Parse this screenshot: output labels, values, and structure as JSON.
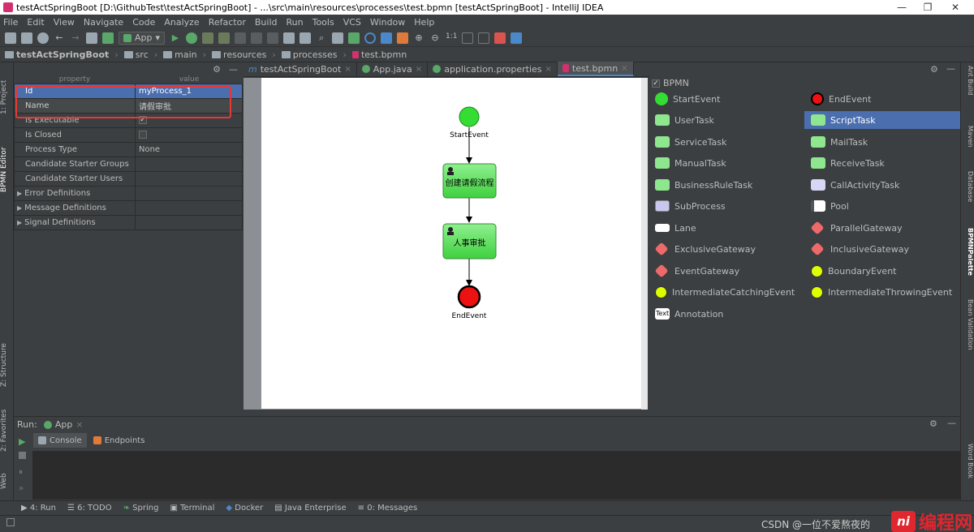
{
  "window": {
    "title": "testActSpringBoot [D:\\GithubTest\\testActSpringBoot] - ...\\src\\main\\resources\\processes\\test.bpmn [testActSpringBoot] - IntelliJ IDEA",
    "minimize": "—",
    "maximize": "❐",
    "close": "✕"
  },
  "menu": [
    "File",
    "Edit",
    "View",
    "Navigate",
    "Code",
    "Analyze",
    "Refactor",
    "Build",
    "Run",
    "Tools",
    "VCS",
    "Window",
    "Help"
  ],
  "toolbar": {
    "run_config": "App"
  },
  "breadcrumb": [
    "testActSpringBoot",
    "src",
    "main",
    "resources",
    "processes",
    "test.bpmn"
  ],
  "left_tabs": {
    "project": "1: Project",
    "bpmn_editor": "BPMN Editor",
    "structure": "Z: Structure",
    "favorites": "2: Favorites",
    "web": "Web"
  },
  "properties": {
    "col_property": "property",
    "col_value": "value",
    "rows": [
      {
        "name": "Id",
        "value": "myProcess_1"
      },
      {
        "name": "Name",
        "value": "请假审批"
      },
      {
        "name": "Is Executable",
        "value": "✓"
      },
      {
        "name": "Is Closed",
        "value": ""
      },
      {
        "name": "Process Type",
        "value": "None"
      },
      {
        "name": "Candidate Starter Groups",
        "value": ""
      },
      {
        "name": "Candidate Starter Users",
        "value": ""
      },
      {
        "name": "Error Definitions",
        "value": ""
      },
      {
        "name": "Message Definitions",
        "value": ""
      },
      {
        "name": "Signal Definitions",
        "value": ""
      }
    ]
  },
  "tabs": [
    {
      "label": "testActSpringBoot"
    },
    {
      "label": "App.java"
    },
    {
      "label": "application.properties"
    },
    {
      "label": "test.bpmn"
    }
  ],
  "diagram": {
    "start": "StartEvent",
    "task1": "创建请假流程",
    "task2": "人事审批",
    "end": "EndEvent"
  },
  "palette": {
    "title": "BPMN",
    "items": [
      "StartEvent",
      "EndEvent",
      "UserTask",
      "ScriptTask",
      "ServiceTask",
      "MailTask",
      "ManualTask",
      "ReceiveTask",
      "BusinessRuleTask",
      "CallActivityTask",
      "SubProcess",
      "Pool",
      "Lane",
      "ParallelGateway",
      "ExclusiveGateway",
      "InclusiveGateway",
      "EventGateway",
      "BoundaryEvent",
      "IntermediateCatchingEvent",
      "IntermediateThrowingEvent",
      "Annotation"
    ],
    "annotation_icon_text": "Text"
  },
  "right_tabs": {
    "ant": "Ant Build",
    "maven": "Maven",
    "database": "Database",
    "palette": "BPMNPalette",
    "bean": "Bean Validation",
    "word": "Word Book"
  },
  "run": {
    "label": "Run:",
    "config": "App",
    "console": "Console",
    "endpoints": "Endpoints"
  },
  "bottom_tools": [
    "4: Run",
    "6: TODO",
    "Spring",
    "Terminal",
    "Docker",
    "Java Enterprise",
    "0: Messages"
  ],
  "watermark": "CSDN @一位不爱熬夜的",
  "logo_text": "编程网",
  "logo_mark": "ni"
}
